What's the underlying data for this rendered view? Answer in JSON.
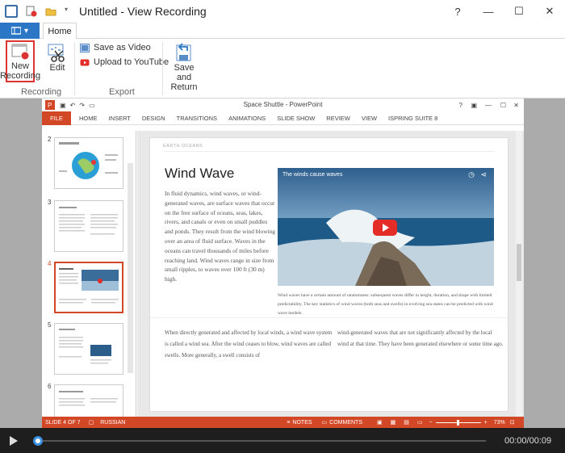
{
  "window": {
    "title": "Untitled - View Recording"
  },
  "tabs": {
    "home": "Home"
  },
  "ribbon": {
    "new_recording": "New Recording",
    "edit": "Edit",
    "save_as_video": "Save as Video",
    "upload_youtube": "Upload to YouTube",
    "save_return": "Save and Return",
    "group_recording": "Recording",
    "group_export": "Export"
  },
  "ppt": {
    "title": "Space Shuttle - PowerPoint",
    "tabs": [
      "FILE",
      "HOME",
      "INSERT",
      "DESIGN",
      "TRANSITIONS",
      "ANIMATIONS",
      "SLIDE SHOW",
      "REVIEW",
      "VIEW",
      "ISPRING SUITE 8"
    ],
    "slide_numbers": [
      "2",
      "3",
      "4",
      "5",
      "6"
    ],
    "slide": {
      "small_header": "EARTH OCEANS",
      "heading": "Wind Wave",
      "body": "In fluid dynamics, wind waves, or wind-generated waves, are surface waves that occur on the free surface of oceans, seas, lakes, rivers, and canals or even on small puddles and ponds. They result from the wind blowing over an area of fluid surface. Waves in the oceans can travel thousands of miles before reaching land. Wind waves range in size from small ripples, to waves over 100 ft (30 m) high.",
      "video_title": "The winds cause waves",
      "caption": "Wind waves have a certain amount of randomness: subsequent waves differ in height, duration, and shape with limited predictability. The key statistics of wind waves (both seas and swells) in evolving sea states can be predicted with wind wave models.",
      "col1": "When directly generated and affected by local winds, a wind wave system is called a wind sea. After the wind ceases to blow, wind waves are called swells. More generally, a swell consists of",
      "col2": "wind-generated waves that are not significantly affected by the local wind at that time. They have been generated elsewhere or some time ago."
    },
    "status": {
      "slide_of": "SLIDE 4 OF 7",
      "language": "RUSSIAN",
      "notes": "NOTES",
      "comments": "COMMENTS",
      "zoom": "73%"
    }
  },
  "player": {
    "time": "00:00/00:09",
    "progress": 0.0
  }
}
